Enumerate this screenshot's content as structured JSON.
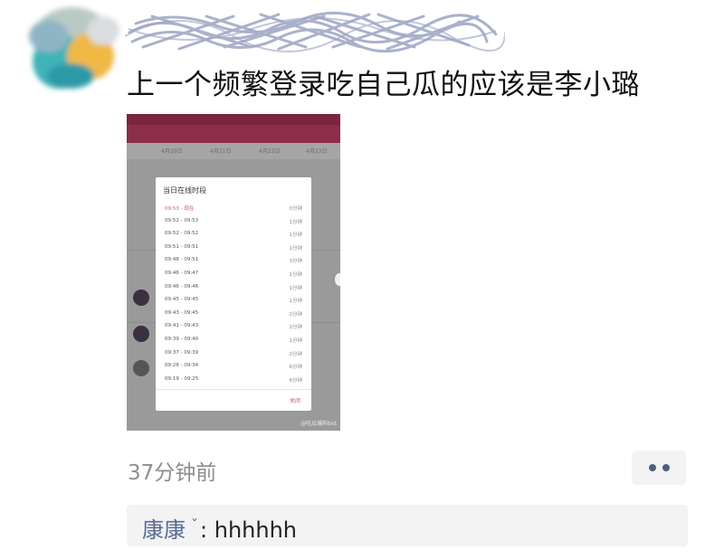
{
  "post": {
    "text": "上一个频繁登录吃自己瓜的应该是李小璐",
    "time": "37分钟前"
  },
  "screenshot": {
    "dialog_title": "当日在线时段",
    "sessions": [
      {
        "range": "09:53 - 现在",
        "duration": "0分钟"
      },
      {
        "range": "09:52 - 09:53",
        "duration": "1分钟"
      },
      {
        "range": "09:52 - 09:52",
        "duration": "1分钟"
      },
      {
        "range": "09:51 - 09:51",
        "duration": "1分钟"
      },
      {
        "range": "09:48 - 09:51",
        "duration": "3分钟"
      },
      {
        "range": "09:46 - 09:47",
        "duration": "1分钟"
      },
      {
        "range": "09:46 - 09:46",
        "duration": "1分钟"
      },
      {
        "range": "09:45 - 09:45",
        "duration": "1分钟"
      },
      {
        "range": "09:43 - 09:45",
        "duration": "2分钟"
      },
      {
        "range": "09:41 - 09:43",
        "duration": "2分钟"
      },
      {
        "range": "09:39 - 09:40",
        "duration": "1分钟"
      },
      {
        "range": "09:37 - 09:39",
        "duration": "2分钟"
      },
      {
        "range": "09:28 - 09:34",
        "duration": "6分钟"
      },
      {
        "range": "09:19 - 09:25",
        "duration": "6分钟"
      }
    ],
    "close_label": "关闭",
    "watermark": "@吃瓜爆料bot",
    "dates": [
      "4月20日",
      "4月21日",
      "4月22日",
      "4月23日"
    ]
  },
  "comment": {
    "author": "康康",
    "emoji": "ˇ",
    "separator": ":",
    "text": "hhhhhh"
  },
  "colors": {
    "link_blue": "#586b95",
    "accent_red": "#c8566f",
    "app_bar": "#8b2d4b"
  }
}
